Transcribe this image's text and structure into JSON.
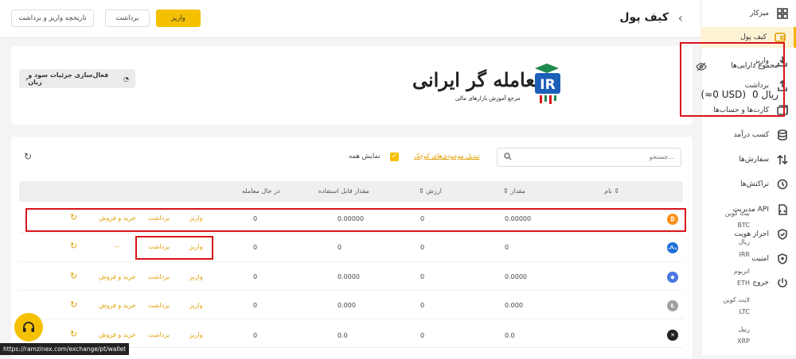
{
  "sidebar": {
    "items": [
      {
        "label": "میزکار",
        "icon": "dashboard-icon"
      },
      {
        "label": "کیف پول",
        "icon": "wallet-icon",
        "active": true
      },
      {
        "label": "واریز",
        "icon": "deposit-icon"
      },
      {
        "label": "برداشت",
        "icon": "withdraw-icon"
      },
      {
        "label": "کارت‌ها و حساب‌ها",
        "icon": "card-icon"
      },
      {
        "label": "کسب درآمد",
        "icon": "database-icon"
      },
      {
        "label": "سفارش‌ها",
        "icon": "orders-icon"
      },
      {
        "label": "تراکنش‌ها",
        "icon": "history-icon"
      },
      {
        "label": "مدیریت API",
        "icon": "api-icon"
      },
      {
        "label": "احراز هویت",
        "icon": "verify-icon"
      },
      {
        "label": "امنیت",
        "icon": "shield-icon"
      },
      {
        "label": "خروج",
        "icon": "power-icon"
      }
    ]
  },
  "header": {
    "title": "کیف پول",
    "deposit_label": "واریز",
    "withdraw_label": "برداشت",
    "history_label": "تاریخچه واریز و برداشت"
  },
  "summary": {
    "total_label": "مجموع دارایی‌ها",
    "total_value": "0 ریال",
    "total_usd": "(≈0 USD)",
    "logo_text": "معامله گر ایرانی",
    "logo_sub": "مرجع آموزش بازارهای مالی",
    "logo_badge": "IR",
    "activate_label": "فعال‌سازی جزئیات سود و زیان"
  },
  "filters": {
    "search_placeholder": "جستجو...",
    "small_label": "تبدیل موجودی‌های کوچک",
    "show_all_label": "نمایش همه"
  },
  "table": {
    "headers": {
      "name": "نام",
      "amount": "مقدار",
      "value": "ارزش",
      "available": "مقدار قابل استفاده",
      "in_trade": "در حال معامله"
    },
    "actions": {
      "deposit": "واریز",
      "withdraw": "برداشت",
      "trade": "خرید و فروش"
    },
    "rows": [
      {
        "name": "بیت کوین",
        "symbol": "BTC",
        "amount": "0.00000",
        "value": "0",
        "available": "0.00000",
        "in_trade": "0",
        "trade": "خرید و فروش",
        "color": "#f7931a",
        "glyph": "₿"
      },
      {
        "name": "ریال",
        "symbol": "IRR",
        "amount": "0",
        "value": "0",
        "available": "0",
        "in_trade": "0",
        "trade": "--",
        "color": "#1e6fd9",
        "glyph": "ریال"
      },
      {
        "name": "اتریوم",
        "symbol": "ETH",
        "amount": "0.0000",
        "value": "0",
        "available": "0.0000",
        "in_trade": "0",
        "trade": "خرید و فروش",
        "color": "#4a74e0",
        "glyph": "◆"
      },
      {
        "name": "لایت کوین",
        "symbol": "LTC",
        "amount": "0.000",
        "value": "0",
        "available": "0.000",
        "in_trade": "0",
        "trade": "خرید و فروش",
        "color": "#a0a0a0",
        "glyph": "Ł"
      },
      {
        "name": "ریپل",
        "symbol": "XRP",
        "amount": "0.0",
        "value": "0",
        "available": "0.0",
        "in_trade": "0",
        "trade": "خرید و فروش",
        "color": "#222222",
        "glyph": "✕"
      }
    ]
  },
  "status_url": "https://ramzinex.com/exchange/pt/wallet",
  "colors": {
    "accent": "#f5c000",
    "highlight": "#d7141a"
  }
}
